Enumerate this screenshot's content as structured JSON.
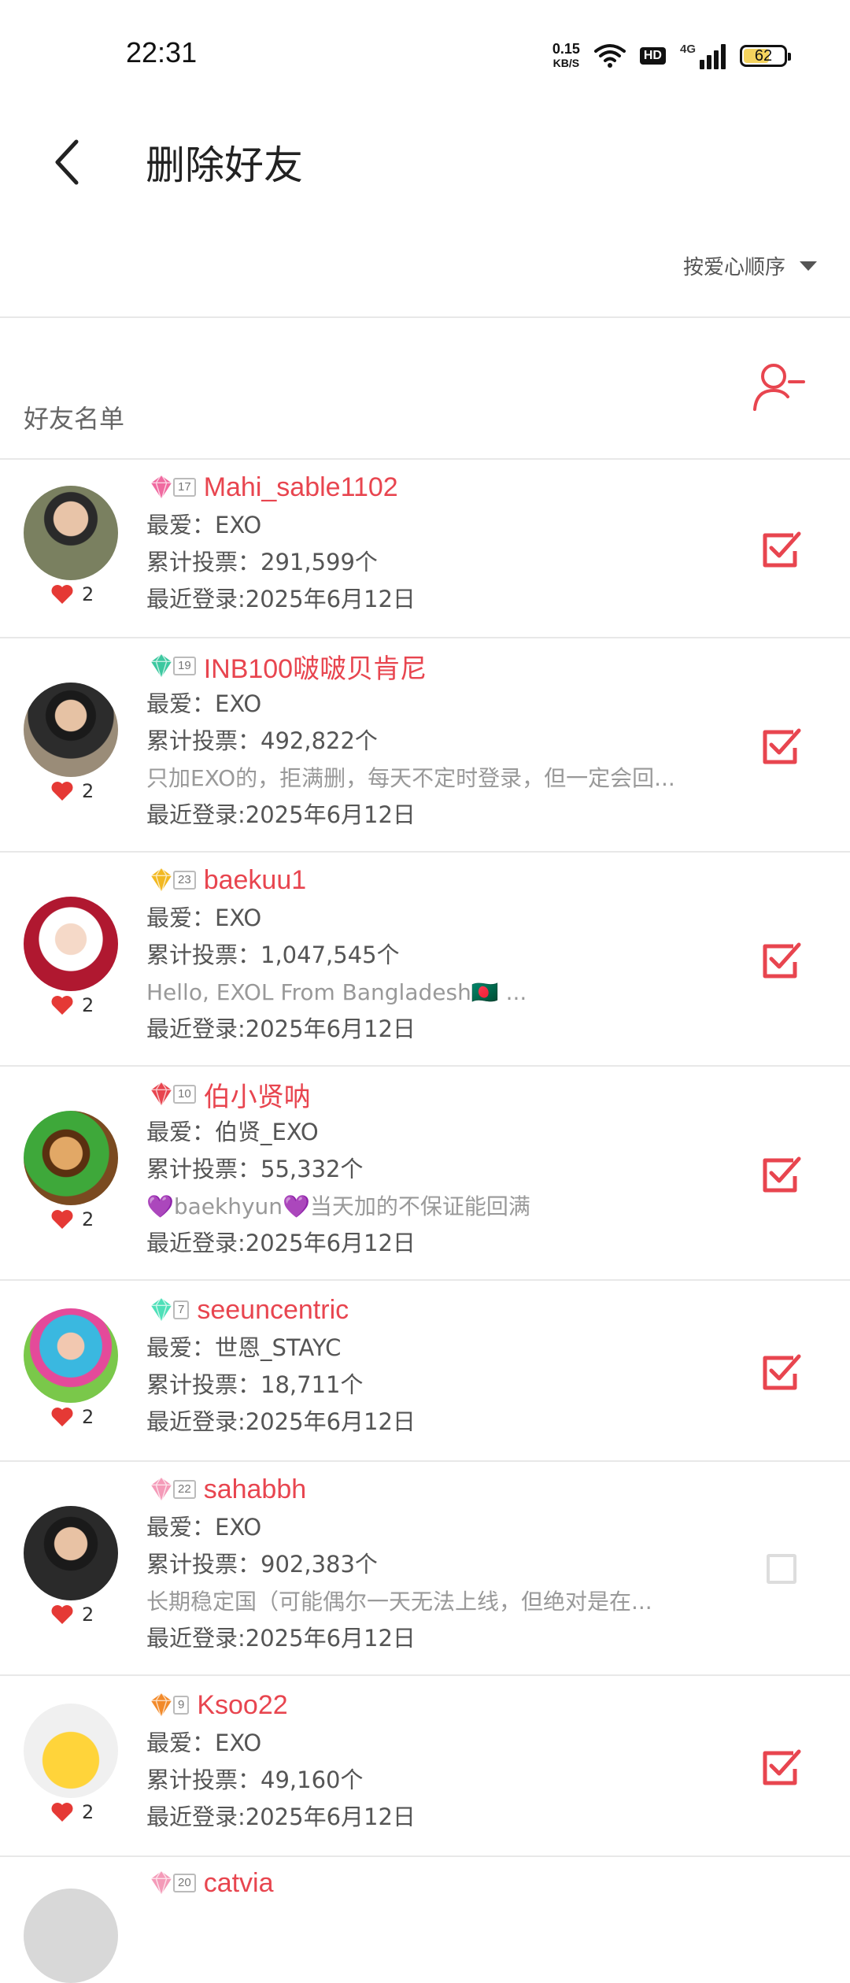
{
  "status_bar": {
    "time": "22:31",
    "net_speed_value": "0.15",
    "net_speed_unit": "KB/S",
    "hd_label": "HD",
    "network_label": "4G",
    "battery_level": "62",
    "battery_fraction": 0.62
  },
  "header": {
    "title": "删除好友"
  },
  "sort": {
    "label": "按爱心顺序"
  },
  "list": {
    "title": "好友名单"
  },
  "colors": {
    "accent": "#e8454f",
    "heart": "#e53935"
  },
  "friends": [
    {
      "level": "17",
      "name": "Mahi_sable1102",
      "favorite": "最爱：EXO",
      "votes": "累计投票：291,599个",
      "bio": "",
      "last_login": "最近登录:2025年6月12日",
      "likes": "2",
      "checked": true
    },
    {
      "level": "19",
      "name": "INB100啵啵贝肯尼",
      "favorite": "最爱：EXO",
      "votes": "累计投票：492,822个",
      "bio": "只加EXO的，拒满删，每天不定时登录，但一定会回...",
      "last_login": "最近登录:2025年6月12日",
      "likes": "2",
      "checked": true
    },
    {
      "level": "23",
      "name": "baekuu1",
      "favorite": "最爱：EXO",
      "votes": "累计投票：1,047,545个",
      "bio": "Hello, EXOL From Bangladesh🇧🇩 ...",
      "last_login": "最近登录:2025年6月12日",
      "likes": "2",
      "checked": true
    },
    {
      "level": "10",
      "name": "伯小贤呐",
      "favorite": "最爱：伯贤_EXO",
      "votes": "累计投票：55,332个",
      "bio": "💜baekhyun💜当天加的不保证能回满",
      "last_login": "最近登录:2025年6月12日",
      "likes": "2",
      "checked": true
    },
    {
      "level": "7",
      "name": "seeuncentric",
      "favorite": "最爱：世恩_STAYC",
      "votes": "累计投票：18,711个",
      "bio": "",
      "last_login": "最近登录:2025年6月12日",
      "likes": "2",
      "checked": true
    },
    {
      "level": "22",
      "name": "sahabbh",
      "favorite": "最爱：EXO",
      "votes": "累计投票：902,383个",
      "bio": "长期稳定国（可能偶尔一天无法上线，但绝对是在...",
      "last_login": "最近登录:2025年6月12日",
      "likes": "2",
      "checked": false
    },
    {
      "level": "9",
      "name": "Ksoo22",
      "favorite": "最爱：EXO",
      "votes": "累计投票：49,160个",
      "bio": "",
      "last_login": "最近登录:2025年6月12日",
      "likes": "2",
      "checked": true
    },
    {
      "level": "20",
      "name": "catvia",
      "favorite": "",
      "votes": "",
      "bio": "",
      "last_login": "",
      "likes": "",
      "checked": false
    }
  ]
}
